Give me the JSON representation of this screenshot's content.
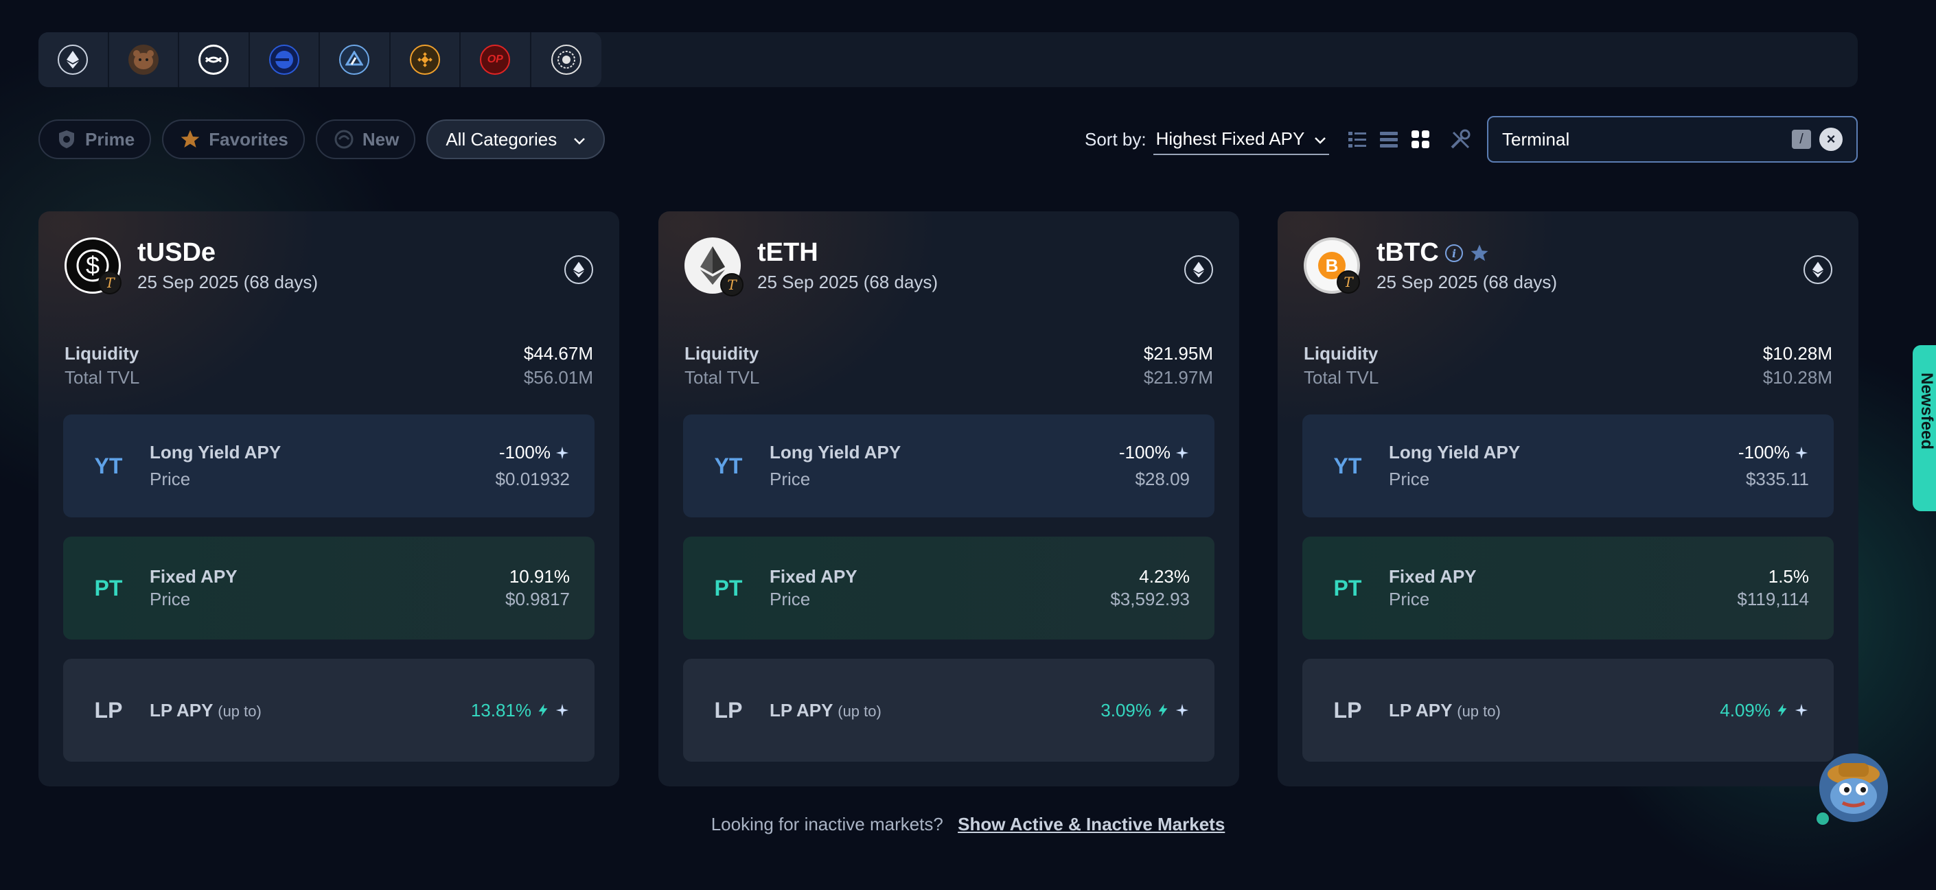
{
  "chains": [
    {
      "name": "ethereum-icon",
      "color": "#c9d1de"
    },
    {
      "name": "bear-chain-icon",
      "color": "#8a5a3a"
    },
    {
      "name": "mantle-icon",
      "color": "#ffffff"
    },
    {
      "name": "base-icon",
      "color": "#2a5ad8"
    },
    {
      "name": "arbitrum-icon",
      "color": "#6ea8e8"
    },
    {
      "name": "bnb-icon",
      "color": "#f0a02c"
    },
    {
      "name": "optimism-icon",
      "color": "#e02424"
    },
    {
      "name": "sonic-icon",
      "color": "#e0e0e0"
    }
  ],
  "filters": {
    "prime": "Prime",
    "favorites": "Favorites",
    "new": "New",
    "category": "All Categories"
  },
  "sort": {
    "label": "Sort by:",
    "value": "Highest Fixed APY"
  },
  "search": {
    "value": "Terminal",
    "shortcut": "/"
  },
  "labels": {
    "liquidity": "Liquidity",
    "tvl": "Total TVL",
    "yt_tag": "YT",
    "pt_tag": "PT",
    "lp_tag": "LP",
    "long_yield": "Long Yield APY",
    "fixed_apy": "Fixed APY",
    "price": "Price",
    "lp_apy": "LP APY",
    "up_to": "(up to)"
  },
  "cards": [
    {
      "name": "tUSDe",
      "date": "25 Sep 2025 (68 days)",
      "liquidity": "$44.67M",
      "tvl": "$56.01M",
      "yt_apy": "-100%",
      "yt_price": "$0.01932",
      "pt_apy": "10.91%",
      "pt_price": "$0.9817",
      "lp_apy": "13.81%"
    },
    {
      "name": "tETH",
      "date": "25 Sep 2025 (68 days)",
      "liquidity": "$21.95M",
      "tvl": "$21.97M",
      "yt_apy": "-100%",
      "yt_price": "$28.09",
      "pt_apy": "4.23%",
      "pt_price": "$3,592.93",
      "lp_apy": "3.09%"
    },
    {
      "name": "tBTC",
      "date": "25 Sep 2025 (68 days)",
      "liquidity": "$10.28M",
      "tvl": "$10.28M",
      "yt_apy": "-100%",
      "yt_price": "$335.11",
      "pt_apy": "1.5%",
      "pt_price": "$119,114",
      "lp_apy": "4.09%"
    }
  ],
  "footer": {
    "question": "Looking for inactive markets?",
    "link": "Show Active & Inactive Markets"
  },
  "newsfeed": "Newsfeed",
  "colors": {
    "background": "#080d1a",
    "accent": "#35d8c0",
    "yt": "#5fa2e8"
  }
}
